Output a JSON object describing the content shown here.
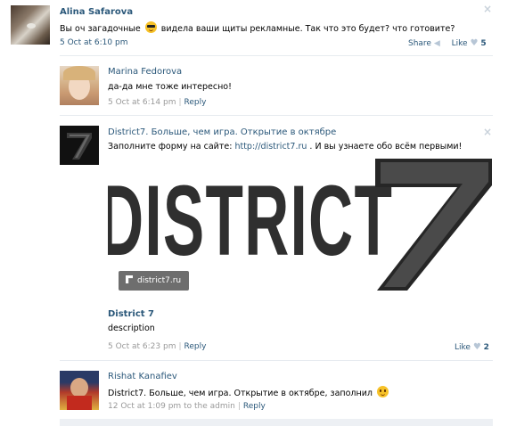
{
  "posts": [
    {
      "author": "Alina Safarova",
      "text_before": "Вы оч загадочные",
      "text_after": "видела ваши щиты рекламные. Так что это будет? что готовите?",
      "emoji": "cool-sunglasses-emoji",
      "time": "5 Oct at 6:10 pm",
      "share_label": "Share",
      "like_label": "Like",
      "like_count": "5"
    }
  ],
  "replies": [
    {
      "author": "Marina Fedorova",
      "text": "да-да мне тоже интересно!",
      "time": "5 Oct at 6:14 pm",
      "reply_label": "Reply"
    },
    {
      "author": "District7. Больше, чем игра. Открытие в октябре",
      "text_before": "Заполните форму на сайте:",
      "url": "http://district7.ru",
      "text_after": ". И вы узнаете обо всём первыми!",
      "banner_word": "DISTRICT",
      "banner_number": "7",
      "banner_tag": "district7.ru",
      "link_title": "District 7",
      "link_description": "description",
      "time": "5 Oct at 6:23 pm",
      "reply_label": "Reply",
      "like_label": "Like",
      "like_count": "2"
    },
    {
      "author": "Rishat Kanafiev",
      "text": "District7. Больше, чем игра. Открытие в октябре, заполнил",
      "emoji": "smile-emoji",
      "time": "12 Oct at 1:09 pm",
      "to_admin": "to the admin",
      "reply_label": "Reply"
    }
  ],
  "icons": {
    "close": "×",
    "heart": "♥",
    "share": "◀"
  }
}
